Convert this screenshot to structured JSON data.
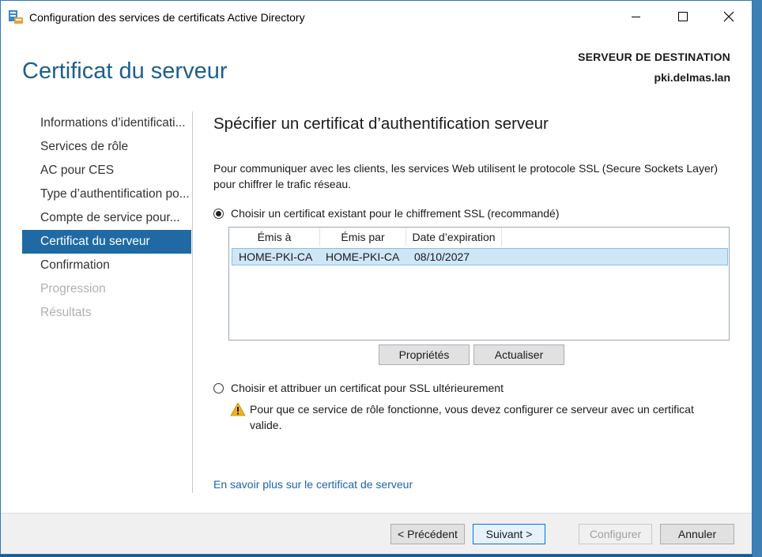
{
  "window": {
    "title": "Configuration des services de certificats Active Directory"
  },
  "header": {
    "page_title": "Certificat du serveur",
    "destination_label": "SERVEUR DE DESTINATION",
    "destination_value": "pki.delmas.lan"
  },
  "nav": {
    "items": [
      {
        "label": "Informations d’identificati...",
        "state": "normal"
      },
      {
        "label": "Services de rôle",
        "state": "normal"
      },
      {
        "label": "AC pour CES",
        "state": "normal"
      },
      {
        "label": "Type d’authentification po...",
        "state": "normal"
      },
      {
        "label": "Compte de service pour...",
        "state": "normal"
      },
      {
        "label": "Certificat du serveur",
        "state": "active"
      },
      {
        "label": "Confirmation",
        "state": "normal"
      },
      {
        "label": "Progression",
        "state": "disabled"
      },
      {
        "label": "Résultats",
        "state": "disabled"
      }
    ]
  },
  "main": {
    "section_title": "Spécifier un certificat d’authentification serveur",
    "description": "Pour communiquer avec les clients, les services Web utilisent le protocole SSL (Secure Sockets Layer) pour chiffrer le trafic réseau.",
    "option_existing": "Choisir un certificat existant pour le chiffrement SSL (recommandé)",
    "table": {
      "columns": [
        "Émis à",
        "Émis par",
        "Date d’expiration"
      ],
      "rows": [
        [
          "HOME-PKI-CA",
          "HOME-PKI-CA",
          "08/10/2027"
        ]
      ]
    },
    "btn_properties": "Propriétés",
    "btn_refresh": "Actualiser",
    "option_later": "Choisir et attribuer un certificat pour SSL ultérieurement",
    "warning": "Pour que ce service de rôle fonctionne, vous devez configurer ce serveur avec un certificat valide.",
    "learn_more": "En savoir plus sur le certificat de serveur"
  },
  "footer": {
    "previous": "< Précédent",
    "next": "Suivant >",
    "configure": "Configurer",
    "cancel": "Annuler"
  },
  "colors": {
    "accent": "#1f6aa5",
    "title_blue": "#1f5e8a",
    "link": "#1c64b3",
    "selection": "#cfe6f7"
  }
}
